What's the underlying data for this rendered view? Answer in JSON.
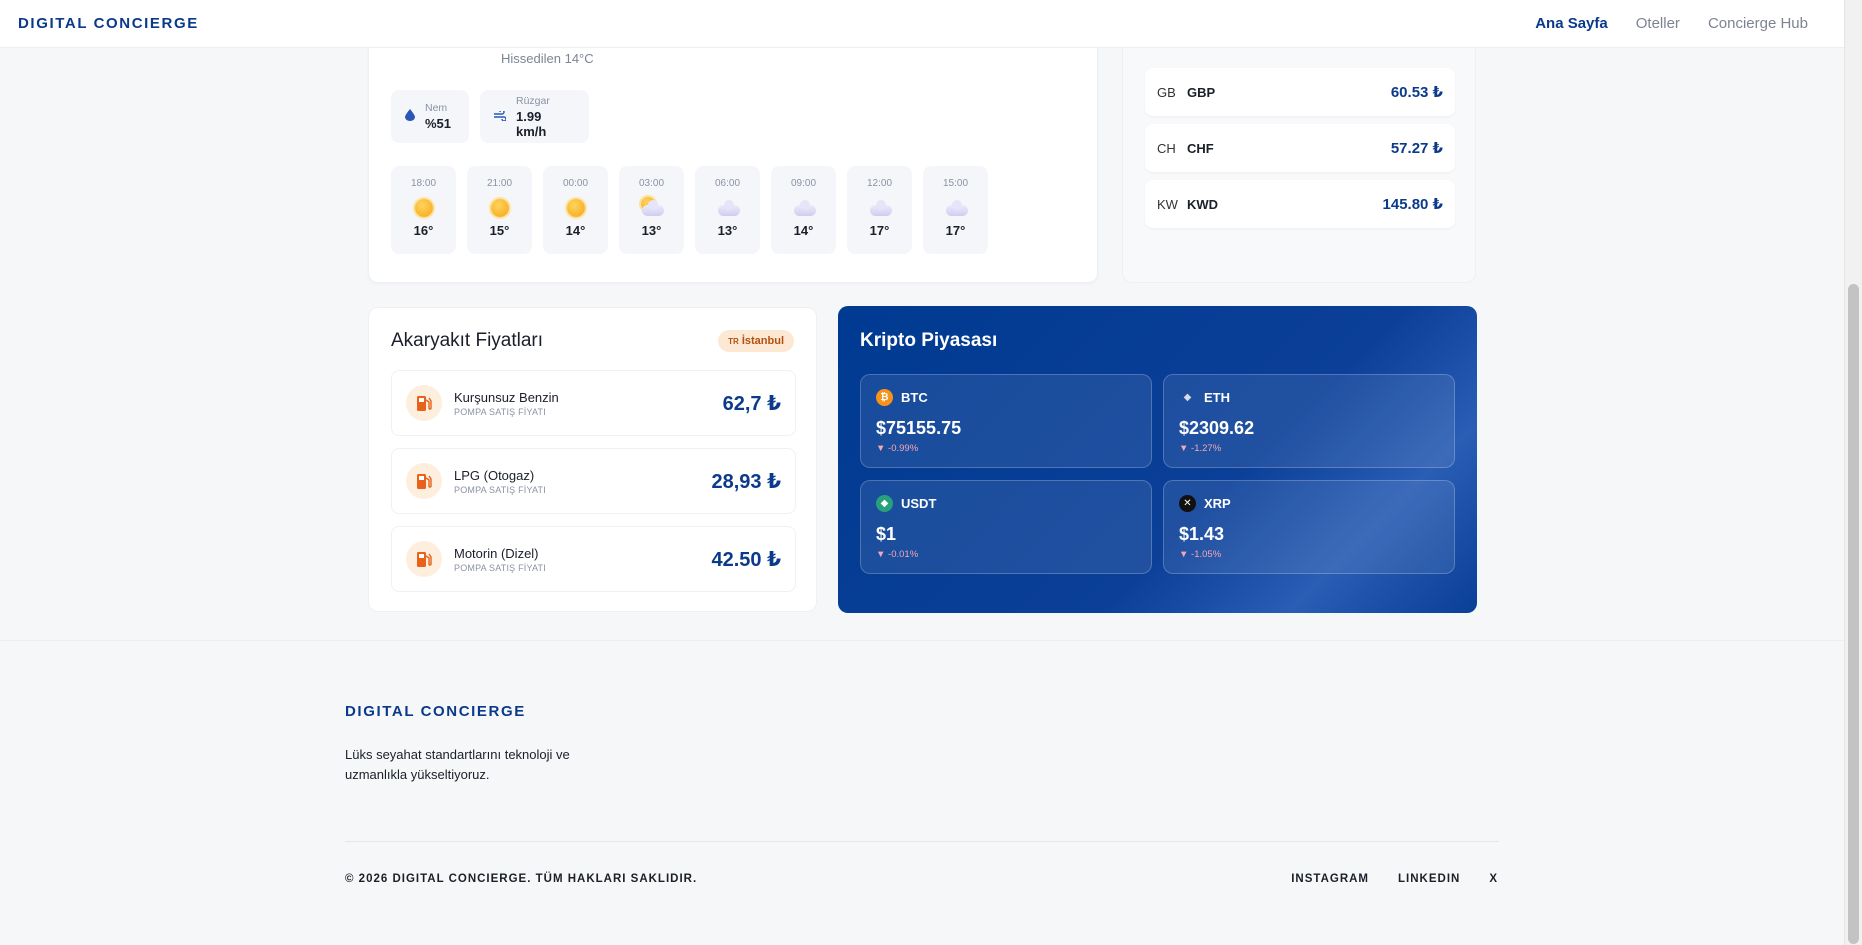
{
  "header": {
    "brand": "DIGITAL CONCIERGE",
    "nav": [
      "Ana Sayfa",
      "Oteller",
      "Concierge Hub"
    ]
  },
  "weather": {
    "feels_like": "Hissedilen 14°C",
    "humidity": {
      "label": "Nem",
      "value": "%51"
    },
    "wind": {
      "label": "Rüzgar",
      "value": "1.99 km/h"
    },
    "hourly": [
      {
        "time": "18:00",
        "temp": "16°",
        "icon": "sun-icon"
      },
      {
        "time": "21:00",
        "temp": "15°",
        "icon": "sun-icon"
      },
      {
        "time": "00:00",
        "temp": "14°",
        "icon": "sun-icon"
      },
      {
        "time": "03:00",
        "temp": "13°",
        "icon": "partly-cloudy-icon"
      },
      {
        "time": "06:00",
        "temp": "13°",
        "icon": "cloud-icon"
      },
      {
        "time": "09:00",
        "temp": "14°",
        "icon": "cloud-icon"
      },
      {
        "time": "12:00",
        "temp": "17°",
        "icon": "cloud-icon"
      },
      {
        "time": "15:00",
        "temp": "17°",
        "icon": "cloud-icon"
      }
    ]
  },
  "currency": [
    {
      "flag": "GB",
      "code": "GBP",
      "rate": "60.53 ₺"
    },
    {
      "flag": "CH",
      "code": "CHF",
      "rate": "57.27 ₺"
    },
    {
      "flag": "KW",
      "code": "KWD",
      "rate": "145.80 ₺"
    }
  ],
  "fuel": {
    "title": "Akaryakıt Fiyatları",
    "badge_flag": "TR",
    "badge_city": "İstanbul",
    "items": [
      {
        "name": "Kurşunsuz Benzin",
        "sub": "POMPA SATIŞ FİYATI",
        "price": "62,7 ₺"
      },
      {
        "name": "LPG (Otogaz)",
        "sub": "POMPA SATIŞ FİYATI",
        "price": "28,93 ₺"
      },
      {
        "name": "Motorin (Dizel)",
        "sub": "POMPA SATIŞ FİYATI",
        "price": "42.50 ₺"
      }
    ]
  },
  "crypto": {
    "title": "Kripto Piyasası",
    "coins": [
      {
        "symbol": "BTC",
        "price": "$75155.75",
        "change": "▼ -0.99%",
        "color": "#f7931a",
        "glyph": "₿"
      },
      {
        "symbol": "ETH",
        "price": "$2309.62",
        "change": "▼ -1.27%",
        "color": "#3a3a3a",
        "glyph": "◆"
      },
      {
        "symbol": "USDT",
        "price": "$1",
        "change": "▼ -0.01%",
        "color": "#26a17b",
        "glyph": "◆"
      },
      {
        "symbol": "XRP",
        "price": "$1.43",
        "change": "▼ -1.05%",
        "color": "#111111",
        "glyph": "✕"
      }
    ]
  },
  "footer": {
    "brand": "DIGITAL CONCIERGE",
    "tagline": "Lüks seyahat standartlarını teknoloji ve uzmanlıkla yükseltiyoruz.",
    "copyright": "© 2026 DIGITAL CONCIERGE. TÜM HAKLARI SAKLIDIR.",
    "links": [
      "INSTAGRAM",
      "LINKEDIN",
      "X"
    ]
  },
  "colors": {
    "primary": "#0b3a8a",
    "accent": "#f4a51c",
    "down": "#f3a8b4"
  }
}
